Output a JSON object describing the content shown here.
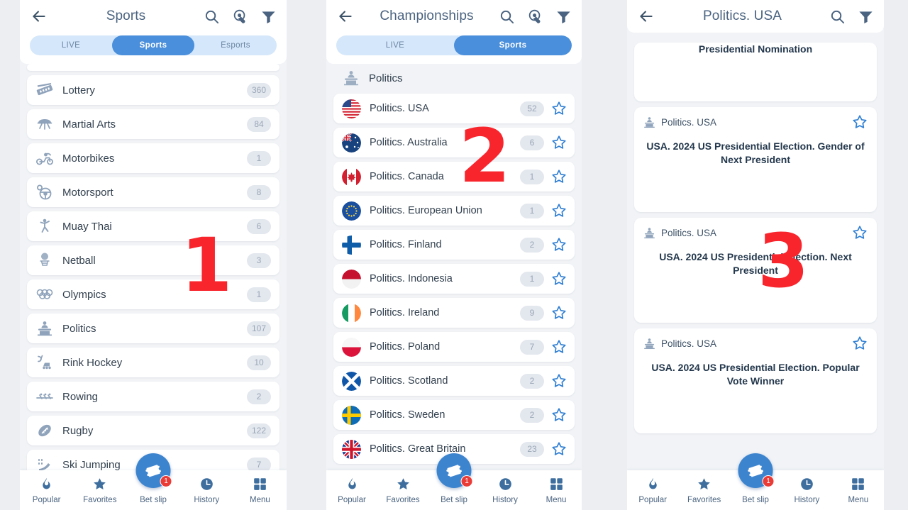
{
  "panel1": {
    "header": {
      "title": "Sports",
      "back_icon": "back-arrow-icon",
      "icons": [
        "search-icon",
        "tap-gesture-icon",
        "filter-icon"
      ]
    },
    "tabs": [
      {
        "label": "LIVE",
        "active": false
      },
      {
        "label": "Sports",
        "active": true
      },
      {
        "label": "Esports",
        "active": false
      }
    ],
    "items": [
      {
        "label": "Lottery",
        "count": "360",
        "icon": "lottery-icon"
      },
      {
        "label": "Martial Arts",
        "count": "84",
        "icon": "martial-arts-icon"
      },
      {
        "label": "Motorbikes",
        "count": "1",
        "icon": "motorbike-icon"
      },
      {
        "label": "Motorsport",
        "count": "8",
        "icon": "motorsport-icon"
      },
      {
        "label": "Muay Thai",
        "count": "6",
        "icon": "muay-thai-icon"
      },
      {
        "label": "Netball",
        "count": "3",
        "icon": "netball-icon"
      },
      {
        "label": "Olympics",
        "count": "1",
        "icon": "olympics-icon"
      },
      {
        "label": "Politics",
        "count": "107",
        "icon": "politics-icon"
      },
      {
        "label": "Rink Hockey",
        "count": "10",
        "icon": "rink-hockey-icon"
      },
      {
        "label": "Rowing",
        "count": "2",
        "icon": "rowing-icon"
      },
      {
        "label": "Rugby",
        "count": "122",
        "icon": "rugby-icon"
      },
      {
        "label": "Ski Jumping",
        "count": "7",
        "icon": "ski-jumping-icon"
      }
    ]
  },
  "panel2": {
    "header": {
      "title": "Championships",
      "back_icon": "back-arrow-icon",
      "icons": [
        "search-icon",
        "tap-gesture-icon",
        "filter-icon"
      ]
    },
    "tabs": [
      {
        "label": "LIVE",
        "active": false
      },
      {
        "label": "Sports",
        "active": true
      }
    ],
    "group": {
      "label": "Politics",
      "icon": "politics-icon"
    },
    "items": [
      {
        "label": "Politics. USA",
        "count": "52",
        "flag": "flag-usa"
      },
      {
        "label": "Politics. Australia",
        "count": "6",
        "flag": "flag-australia"
      },
      {
        "label": "Politics. Canada",
        "count": "1",
        "flag": "flag-canada"
      },
      {
        "label": "Politics. European Union",
        "count": "1",
        "flag": "flag-european-union"
      },
      {
        "label": "Politics. Finland",
        "count": "2",
        "flag": "flag-finland"
      },
      {
        "label": "Politics. Indonesia",
        "count": "1",
        "flag": "flag-indonesia"
      },
      {
        "label": "Politics. Ireland",
        "count": "9",
        "flag": "flag-ireland"
      },
      {
        "label": "Politics. Poland",
        "count": "7",
        "flag": "flag-poland"
      },
      {
        "label": "Politics. Scotland",
        "count": "2",
        "flag": "flag-scotland"
      },
      {
        "label": "Politics. Sweden",
        "count": "2",
        "flag": "flag-sweden"
      },
      {
        "label": "Politics. Great Britain",
        "count": "23",
        "flag": "flag-great-britain"
      }
    ]
  },
  "panel3": {
    "header": {
      "title": "Politics. USA",
      "back_icon": "back-arrow-icon",
      "icons": [
        "search-icon",
        "filter-icon"
      ]
    },
    "partial_card": {
      "title": "Presidential Nomination"
    },
    "cards": [
      {
        "category": "Politics. USA",
        "title": "USA. 2024 US Presidential Election. Gender of Next President"
      },
      {
        "category": "Politics. USA",
        "title": "USA. 2024 US Presidential Election. Next President"
      },
      {
        "category": "Politics. USA",
        "title": "USA. 2024 US Presidential Election. Popular Vote Winner"
      }
    ]
  },
  "bottom_nav": {
    "items": [
      {
        "label": "Popular",
        "icon": "flame-icon"
      },
      {
        "label": "Favorites",
        "icon": "star-icon"
      },
      {
        "label": "Bet slip",
        "icon": "ticket-icon",
        "badge": "1"
      },
      {
        "label": "History",
        "icon": "clock-icon"
      },
      {
        "label": "Menu",
        "icon": "grid-icon"
      }
    ]
  },
  "annotations": {
    "step1": "1",
    "step2": "2",
    "step3": "3"
  },
  "colors": {
    "accent": "#4a8fdb",
    "tab_inactive_bg": "#d5e7fa",
    "page_bg": "#f1f3f6",
    "text": "#33414f",
    "badge_red": "#ea3b37",
    "step_red": "#f8252d"
  }
}
